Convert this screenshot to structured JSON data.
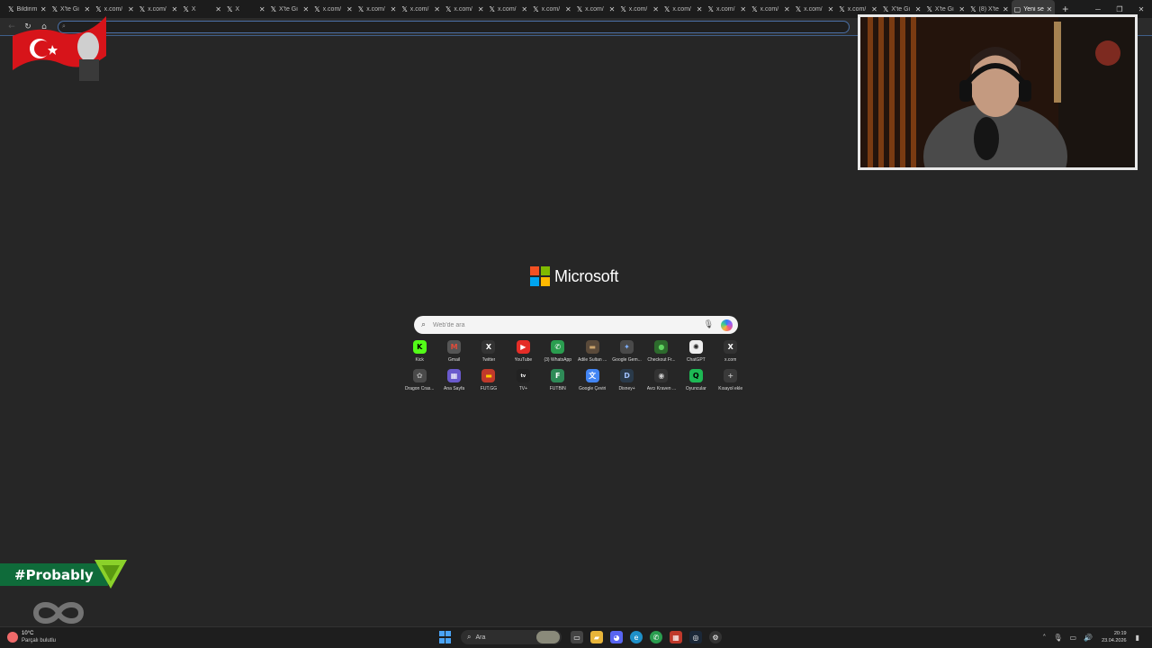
{
  "tabs": [
    {
      "label": "Bildirim",
      "icon": "x-icon"
    },
    {
      "label": "X'te Gi",
      "icon": "x-icon"
    },
    {
      "label": "x.com/",
      "icon": "x-icon"
    },
    {
      "label": "x.com/",
      "icon": "x-icon"
    },
    {
      "label": "X",
      "icon": "x-icon"
    },
    {
      "label": "X",
      "icon": "x-icon"
    },
    {
      "label": "X'te Gi",
      "icon": "x-icon"
    },
    {
      "label": "x.com/",
      "icon": "x-icon"
    },
    {
      "label": "x.com/",
      "icon": "x-icon"
    },
    {
      "label": "x.com/",
      "icon": "x-icon"
    },
    {
      "label": "x.com/",
      "icon": "x-icon"
    },
    {
      "label": "x.com/",
      "icon": "x-icon"
    },
    {
      "label": "x.com/",
      "icon": "x-icon"
    },
    {
      "label": "x.com/",
      "icon": "x-icon"
    },
    {
      "label": "x.com/",
      "icon": "x-icon"
    },
    {
      "label": "x.com/",
      "icon": "x-icon"
    },
    {
      "label": "x.com/",
      "icon": "x-icon"
    },
    {
      "label": "x.com/",
      "icon": "x-icon"
    },
    {
      "label": "x.com/",
      "icon": "x-icon"
    },
    {
      "label": "x.com/",
      "icon": "x-icon"
    },
    {
      "label": "X'te Gi",
      "icon": "x-icon"
    },
    {
      "label": "X'te Gi",
      "icon": "x-icon"
    },
    {
      "label": "(8) X'te",
      "icon": "x-icon"
    },
    {
      "label": "Yeni se",
      "icon": "newtab-icon",
      "active": true
    }
  ],
  "brand": {
    "name": "Microsoft",
    "colors": [
      "#f25022",
      "#7fba00",
      "#00a4ef",
      "#ffb900"
    ]
  },
  "search": {
    "placeholder": "Web'de ara"
  },
  "tiles": [
    {
      "label": "Kick",
      "icon": "K",
      "color": "#53fc18",
      "fg": "#000000"
    },
    {
      "label": "Gmail",
      "icon": "M",
      "color": "#555555",
      "fg": "#e24b3a"
    },
    {
      "label": "Twitter",
      "icon": "X",
      "color": "#333333",
      "fg": "#ffffff"
    },
    {
      "label": "YouTube",
      "icon": "▶",
      "color": "#e52d27",
      "fg": "#ffffff"
    },
    {
      "label": "(3) WhatsApp",
      "icon": "✆",
      "color": "#2a9d4f",
      "fg": "#ffffff"
    },
    {
      "label": "Adile Sultan ...",
      "icon": "▬",
      "color": "#5a4a3a",
      "fg": "#c9a16a"
    },
    {
      "label": "Google Gem...",
      "icon": "✦",
      "color": "#4a4a4a",
      "fg": "#7fb0ff"
    },
    {
      "label": "Checkout Fr...",
      "icon": "●",
      "color": "#2d6b2d",
      "fg": "#5fd35f"
    },
    {
      "label": "ChatGPT",
      "icon": "✺",
      "color": "#eeeeee",
      "fg": "#222222"
    },
    {
      "label": "x.com",
      "icon": "X",
      "color": "#333333",
      "fg": "#ffffff"
    },
    {
      "label": "Dragon Cras...",
      "icon": "✿",
      "color": "#4a4a4a",
      "fg": "#aaaaaa"
    },
    {
      "label": "Ana Sayfa",
      "icon": "▦",
      "color": "#6a5acd",
      "fg": "#ffffff"
    },
    {
      "label": "FUT.GG",
      "icon": "▬",
      "color": "#c0392b",
      "fg": "#ffcc00"
    },
    {
      "label": "TV+",
      "icon": "tv",
      "color": "#222222",
      "fg": "#ffffff"
    },
    {
      "label": "FUTBIN",
      "icon": "F",
      "color": "#2e8b57",
      "fg": "#ffffff"
    },
    {
      "label": "Google Çeviri",
      "icon": "文",
      "color": "#4285f4",
      "fg": "#ffffff"
    },
    {
      "label": "Disney+",
      "icon": "D",
      "color": "#2a3a4a",
      "fg": "#9fc1ff"
    },
    {
      "label": "Avcı Kraven ...",
      "icon": "◉",
      "color": "#333333",
      "fg": "#cccccc"
    },
    {
      "label": "Oyuncular",
      "icon": "Q",
      "color": "#1db954",
      "fg": "#000000"
    },
    {
      "label": "Kısayol ekle",
      "icon": "+",
      "color": "#3a3a3a",
      "fg": "#bbbbbb"
    }
  ],
  "overlay": {
    "tag": "#Probably"
  },
  "taskbar": {
    "weather_temp": "10°C",
    "weather_condition": "Parçalı bulutlu",
    "search_label": "Ara",
    "time": "20:19",
    "date": "23.04.2026"
  }
}
